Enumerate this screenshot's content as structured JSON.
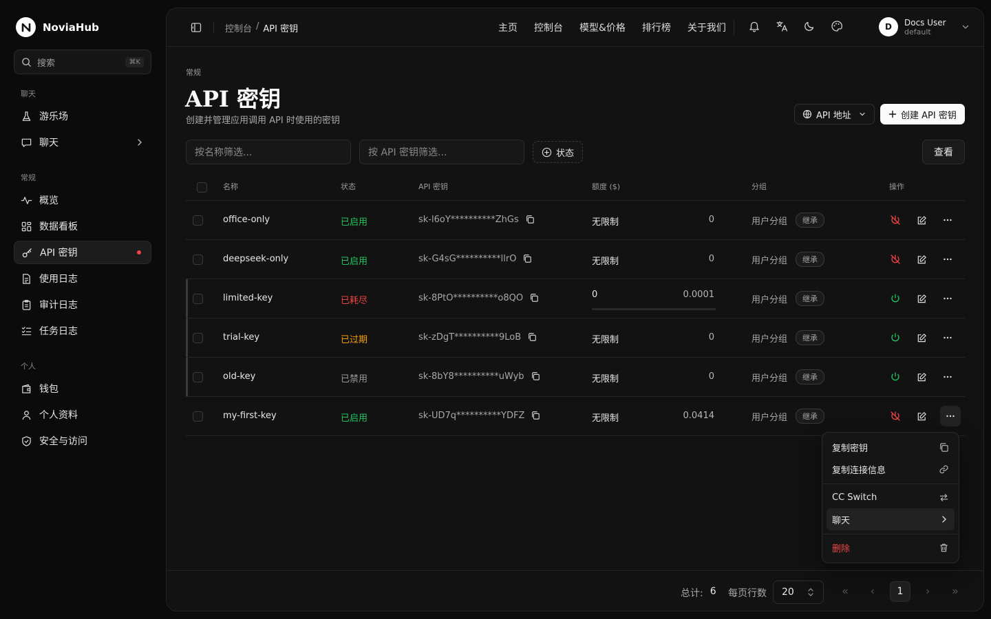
{
  "brand": {
    "name": "NoviaHub"
  },
  "search": {
    "placeholder": "搜索",
    "shortcut": "⌘K"
  },
  "sidebar": {
    "sections": [
      {
        "label": "聊天",
        "items": [
          {
            "label": "游乐场",
            "icon": "flask-icon"
          },
          {
            "label": "聊天",
            "icon": "chat-icon"
          }
        ]
      },
      {
        "label": "常规",
        "items": [
          {
            "label": "概览",
            "icon": "activity-icon"
          },
          {
            "label": "数据看板",
            "icon": "dashboard-icon"
          },
          {
            "label": "API 密钥",
            "icon": "key-icon",
            "active": true
          },
          {
            "label": "使用日志",
            "icon": "file-text-icon"
          },
          {
            "label": "审计日志",
            "icon": "clipboard-icon"
          },
          {
            "label": "任务日志",
            "icon": "list-check-icon"
          }
        ]
      },
      {
        "label": "个人",
        "items": [
          {
            "label": "钱包",
            "icon": "wallet-icon"
          },
          {
            "label": "个人资料",
            "icon": "user-icon"
          },
          {
            "label": "安全与访问",
            "icon": "shield-icon"
          }
        ]
      }
    ]
  },
  "topbar": {
    "breadcrumb": [
      "控制台",
      "/",
      "API 密钥"
    ],
    "nav": [
      "主页",
      "控制台",
      "模型&价格",
      "排行榜",
      "关于我们"
    ],
    "user": {
      "initial": "D",
      "name": "Docs User",
      "group": "default"
    }
  },
  "page": {
    "eyebrow": "常规",
    "title": "API 密钥",
    "subtitle": "创建并管理应用调用 API 时使用的密钥",
    "api_address_btn": "API 地址",
    "create_btn": "创建 API 密钥",
    "filter_name_placeholder": "按名称筛选...",
    "filter_key_placeholder": "按 API 密钥筛选...",
    "status_filter": "状态",
    "view_btn": "查看"
  },
  "table": {
    "headers": {
      "name": "名称",
      "status": "状态",
      "key": "API 密钥",
      "quota": "额度 ($)",
      "group": "分组",
      "actions": "操作"
    },
    "rows": [
      {
        "name": "office-only",
        "status": "已启用",
        "status_color": "#22c55e",
        "key": "sk-l6oY**********ZhGs",
        "quota": "无限制",
        "used": "0",
        "group": "用户分组",
        "badge": "继承",
        "toggle": "disable"
      },
      {
        "name": "deepseek-only",
        "status": "已启用",
        "status_color": "#22c55e",
        "key": "sk-G4sG**********llrO",
        "quota": "无限制",
        "used": "0",
        "group": "用户分组",
        "badge": "继承",
        "toggle": "disable"
      },
      {
        "name": "limited-key",
        "status": "已耗尽",
        "status_color": "#ef4444",
        "key": "sk-8PtO**********o8QO",
        "quota": "0",
        "used": "0.0001",
        "group": "用户分组",
        "badge": "继承",
        "toggle": "enable",
        "progress": 0
      },
      {
        "name": "trial-key",
        "status": "已过期",
        "status_color": "#f59e0b",
        "key": "sk-zDgT**********9LoB",
        "quota": "无限制",
        "used": "0",
        "group": "用户分组",
        "badge": "继承",
        "toggle": "enable"
      },
      {
        "name": "old-key",
        "status": "已禁用",
        "status_color": "#9a9a9a",
        "key": "sk-8bY8**********uWyb",
        "quota": "无限制",
        "used": "0",
        "group": "用户分组",
        "badge": "继承",
        "toggle": "enable"
      },
      {
        "name": "my-first-key",
        "status": "已启用",
        "status_color": "#22c55e",
        "key": "sk-UD7q**********YDFZ",
        "quota": "无限制",
        "used": "0.0414",
        "group": "用户分组",
        "badge": "继承",
        "toggle": "disable"
      }
    ]
  },
  "menu": {
    "items": [
      {
        "label": "复制密钥",
        "icon": "copy-icon"
      },
      {
        "label": "复制连接信息",
        "icon": "link-icon"
      },
      {
        "label": "CC Switch",
        "icon": "switch-arrows-icon"
      },
      {
        "label": "聊天",
        "icon": "chevron-right-icon"
      },
      {
        "label": "删除",
        "icon": "trash-icon"
      }
    ]
  },
  "footer": {
    "total_label": "总计:",
    "total": "6",
    "rows_label": "每页行数",
    "rows_value": "20",
    "page": "1"
  }
}
